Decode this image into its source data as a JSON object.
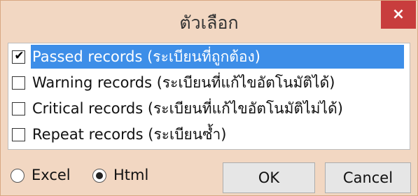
{
  "window": {
    "title": "ตัวเลือก",
    "close_glyph": "×"
  },
  "records": [
    {
      "label": "Passed records (ระเบียนที่ถูกต้อง)",
      "checked": true,
      "check_glyph": "✔"
    },
    {
      "label": "Warning records (ระเบียนที่แก้ไขอัตโนมัติได้)",
      "checked": false,
      "check_glyph": ""
    },
    {
      "label": "Critical records (ระเบียนที่แก้ไขอัตโนมัติไม่ได้)",
      "checked": false,
      "check_glyph": ""
    },
    {
      "label": "Repeat records (ระเบียนซ้ำ)",
      "checked": false,
      "check_glyph": ""
    }
  ],
  "format": {
    "options": [
      {
        "label": "Excel",
        "selected": false
      },
      {
        "label": "Html",
        "selected": true
      }
    ]
  },
  "buttons": {
    "ok_label": "OK",
    "cancel_label": "Cancel"
  },
  "colors": {
    "selection": "#3d8ee8",
    "close_button": "#c83d3d",
    "dialog_background": "#f2d7c2"
  }
}
